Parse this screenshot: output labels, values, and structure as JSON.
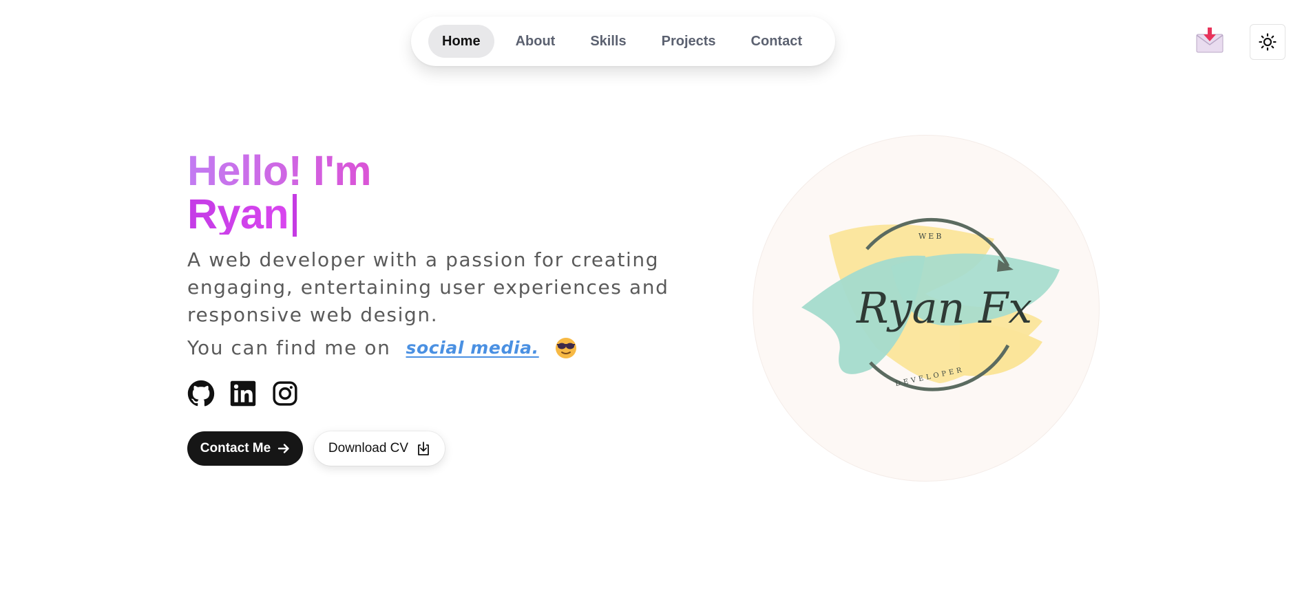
{
  "nav": {
    "items": [
      {
        "label": "Home",
        "active": true
      },
      {
        "label": "About",
        "active": false
      },
      {
        "label": "Skills",
        "active": false
      },
      {
        "label": "Projects",
        "active": false
      },
      {
        "label": "Contact",
        "active": false
      }
    ]
  },
  "topbar": {
    "mail_icon": "mail-download-icon",
    "theme_icon": "sun-icon"
  },
  "hero": {
    "greeting": "Hello! I'm",
    "name": "Ryan",
    "description": "A web developer with a passion for creating engaging, entertaining user experiences and responsive web design.",
    "find_prefix": "You can find me on",
    "social_link": "social media.",
    "emoji": "sunglasses-emoji",
    "socials": [
      "github-icon",
      "linkedin-icon",
      "instagram-icon"
    ],
    "contact_button": "Contact Me",
    "cv_button": "Download CV"
  },
  "logo": {
    "top_text": "WEB",
    "script_text": "Ryan Fx",
    "bottom_text": "DEVELOPER"
  },
  "colors": {
    "gradient_start": "#c27cf2",
    "gradient_end": "#ec4899",
    "link": "#4a90e2",
    "dark_button": "#161616",
    "mint": "#a6dccd",
    "yellow": "#fbe59a",
    "ring": "#5b6b60"
  }
}
